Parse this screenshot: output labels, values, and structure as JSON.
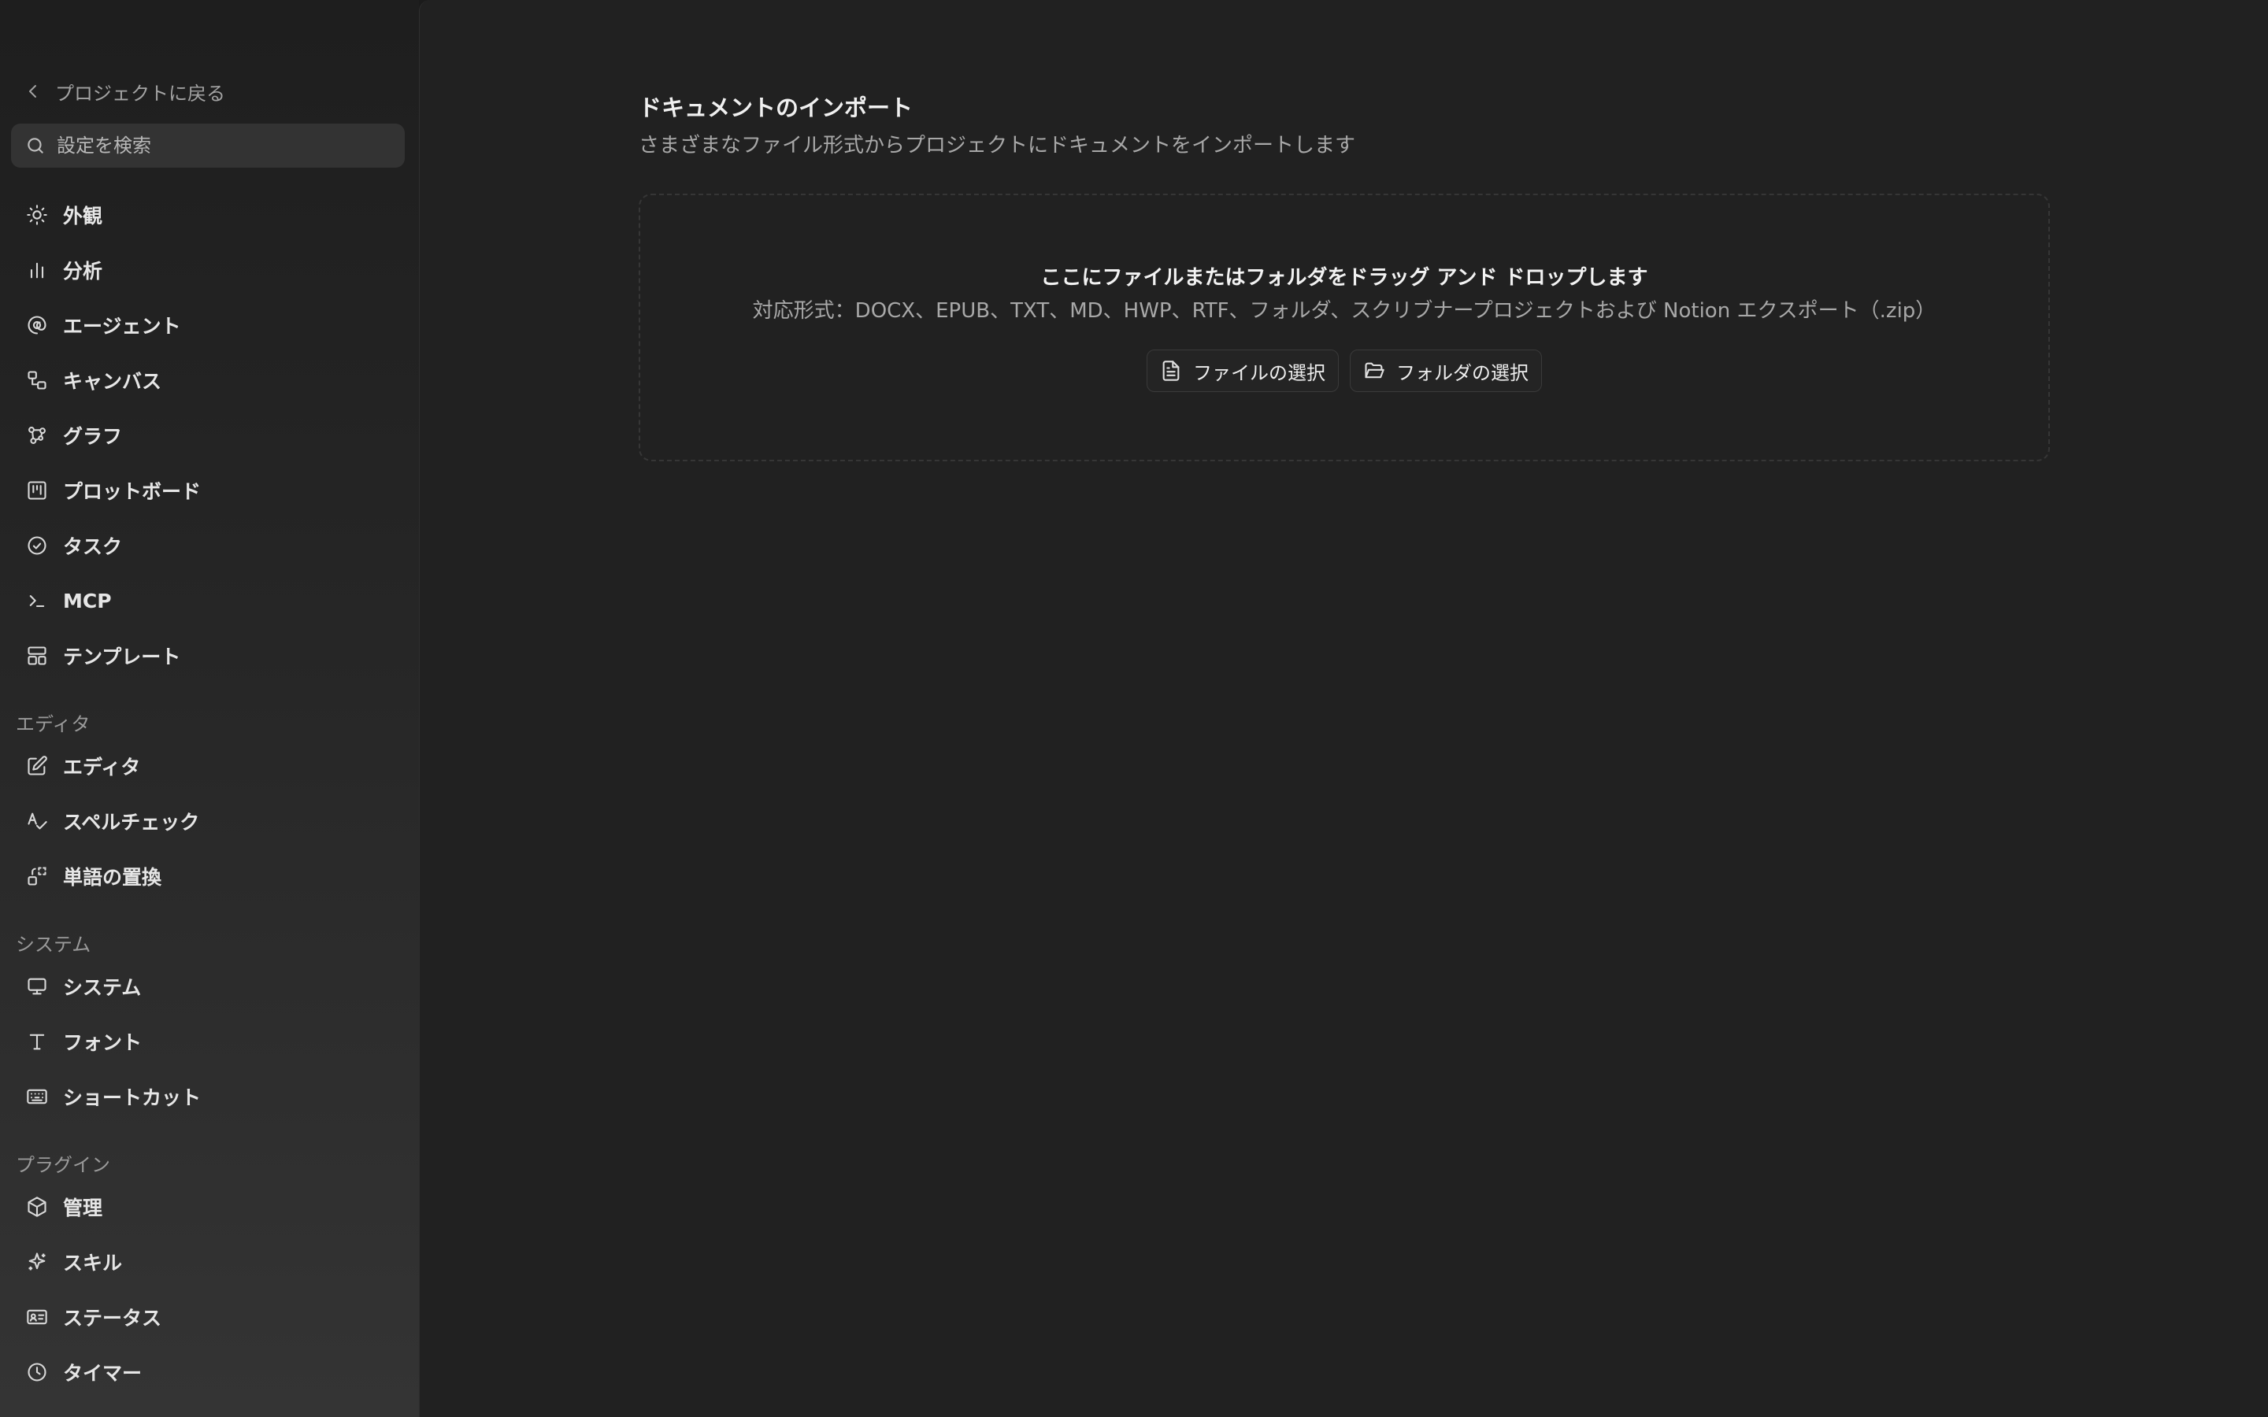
{
  "sidebar": {
    "back_label": "プロジェクトに戻る",
    "search_placeholder": "設定を検索",
    "items": [
      {
        "label": "外観",
        "icon": "sun-icon"
      },
      {
        "label": "分析",
        "icon": "bar-chart-icon"
      },
      {
        "label": "エージェント",
        "icon": "spiral-icon"
      },
      {
        "label": "キャンバス",
        "icon": "canvas-icon"
      },
      {
        "label": "グラフ",
        "icon": "graph-icon"
      },
      {
        "label": "プロットボード",
        "icon": "kanban-icon"
      },
      {
        "label": "タスク",
        "icon": "check-circle-icon"
      },
      {
        "label": "MCP",
        "icon": "terminal-icon"
      },
      {
        "label": "テンプレート",
        "icon": "template-icon"
      }
    ],
    "sections": [
      {
        "title": "エディタ",
        "items": [
          {
            "label": "エディタ",
            "icon": "edit-icon"
          },
          {
            "label": "スペルチェック",
            "icon": "spell-check-icon"
          },
          {
            "label": "単語の置換",
            "icon": "replace-icon"
          }
        ]
      },
      {
        "title": "システム",
        "items": [
          {
            "label": "システム",
            "icon": "monitor-icon"
          },
          {
            "label": "フォント",
            "icon": "type-icon"
          },
          {
            "label": "ショートカット",
            "icon": "keyboard-icon"
          }
        ]
      },
      {
        "title": "プラグイン",
        "items": [
          {
            "label": "管理",
            "icon": "package-icon"
          },
          {
            "label": "スキル",
            "icon": "sparkle-icon"
          },
          {
            "label": "ステータス",
            "icon": "id-card-icon"
          },
          {
            "label": "タイマー",
            "icon": "clock-icon"
          }
        ]
      }
    ]
  },
  "main": {
    "title": "ドキュメントのインポート",
    "subtitle": "さまざまなファイル形式からプロジェクトにドキュメントをインポートします",
    "dropzone": {
      "title": "ここにファイルまたはフォルダをドラッグ アンド ドロップします",
      "formats": "対応形式：DOCX、EPUB、TXT、MD、HWP、RTF、フォルダ、スクリブナープロジェクトおよび Notion エクスポート（.zip）",
      "select_file_label": "ファイルの選択",
      "select_folder_label": "フォルダの選択"
    }
  },
  "colors": {
    "background": "#212121",
    "sidebar_top": "#1e1e1e",
    "sidebar_bottom": "#343434",
    "text_primary": "#e6e6e6",
    "text_secondary": "#a8a8a8"
  }
}
